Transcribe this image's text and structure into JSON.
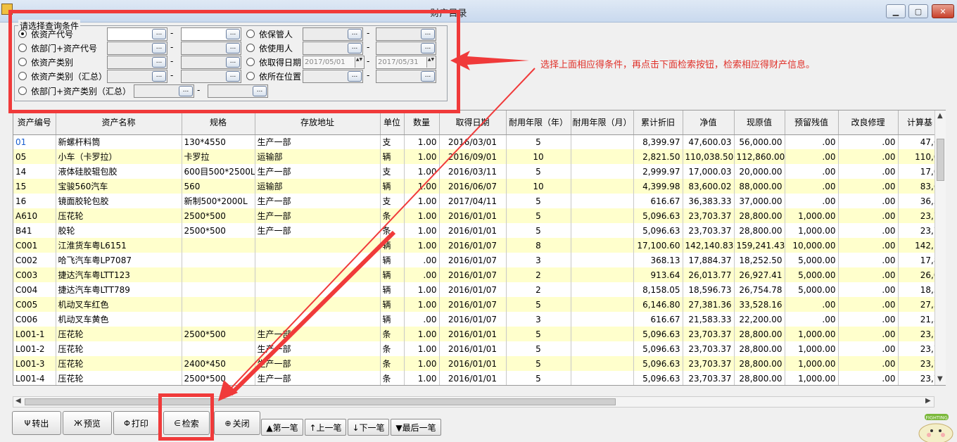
{
  "window": {
    "title": "财产目录",
    "min": "▁",
    "max": "▢",
    "close": "✕"
  },
  "filter": {
    "legend": "请选择查询条件",
    "left": [
      {
        "label": "依资产代号",
        "selected": true
      },
      {
        "label": "依部门+资产代号",
        "selected": false
      },
      {
        "label": "依资产类别",
        "selected": false
      },
      {
        "label": "依资产类别（汇总）",
        "selected": false
      },
      {
        "label": "依部门+资产类别（汇总）",
        "selected": false
      }
    ],
    "right": [
      {
        "label": "依保管人",
        "selected": false
      },
      {
        "label": "依使用人",
        "selected": false
      },
      {
        "label": "依取得日期",
        "selected": false
      },
      {
        "label": "依所在位置",
        "selected": false
      }
    ],
    "date_from": "2017/05/01",
    "date_to": "2017/05/31",
    "dash": "-",
    "dots": "..."
  },
  "annotation": "选择上面相应得条件，再点击下面检索按钮，检索相应得财产信息。",
  "table": {
    "columns": [
      "资产编号",
      "资产名称",
      "规格",
      "存放地址",
      "单位",
      "数量",
      "取得日期",
      "耐用年限（年）",
      "耐用年限（月）",
      "累计折旧",
      "净值",
      "现原值",
      "预留残值",
      "改良修理",
      "计算基"
    ],
    "rows": [
      [
        "01",
        "新螺杆料筒",
        "130*4550",
        "生产一部",
        "支",
        "1.00",
        "2016/03/01",
        "5",
        "",
        "8,399.97",
        "47,600.03",
        "56,000.00",
        ".00",
        ".00",
        "47,6"
      ],
      [
        "05",
        "小车（卡罗拉）",
        "卡罗拉",
        "运输部",
        "辆",
        "1.00",
        "2016/09/01",
        "10",
        "",
        "2,821.50",
        "110,038.50",
        "112,860.00",
        ".00",
        ".00",
        "110,0"
      ],
      [
        "14",
        "液体硅胶辊包胶",
        "600目500*2500L",
        "生产一部",
        "支",
        "1.00",
        "2016/03/11",
        "5",
        "",
        "2,999.97",
        "17,000.03",
        "20,000.00",
        ".00",
        ".00",
        "17,0"
      ],
      [
        "15",
        "宝骏560汽车",
        "560",
        "运输部",
        "辆",
        "1.00",
        "2016/06/07",
        "10",
        "",
        "4,399.98",
        "83,600.02",
        "88,000.00",
        ".00",
        ".00",
        "83,6"
      ],
      [
        "16",
        "镜面胶轮包胶",
        "新制500*2000L",
        "生产一部",
        "支",
        "1.00",
        "2017/04/11",
        "5",
        "",
        "616.67",
        "36,383.33",
        "37,000.00",
        ".00",
        ".00",
        "36,3"
      ],
      [
        "A610",
        "压花轮",
        "2500*500",
        "生产一部",
        "条",
        "1.00",
        "2016/01/01",
        "5",
        "",
        "5,096.63",
        "23,703.37",
        "28,800.00",
        "1,000.00",
        ".00",
        "23,7"
      ],
      [
        "B41",
        "胶轮",
        "2500*500",
        "生产一部",
        "条",
        "1.00",
        "2016/01/01",
        "5",
        "",
        "5,096.63",
        "23,703.37",
        "28,800.00",
        "1,000.00",
        ".00",
        "23,7"
      ],
      [
        "C001",
        "江淮货车粤L6151",
        "",
        "",
        "辆",
        "1.00",
        "2016/01/07",
        "8",
        "",
        "17,100.60",
        "142,140.83",
        "159,241.43",
        "10,000.00",
        ".00",
        "142,1"
      ],
      [
        "C002",
        "哈飞汽车粤LP7087",
        "",
        "",
        "辆",
        ".00",
        "2016/01/07",
        "3",
        "",
        "368.13",
        "17,884.37",
        "18,252.50",
        "5,000.00",
        ".00",
        "17,8"
      ],
      [
        "C003",
        "捷达汽车粤LTT123",
        "",
        "",
        "辆",
        ".00",
        "2016/01/07",
        "2",
        "",
        "913.64",
        "26,013.77",
        "26,927.41",
        "5,000.00",
        ".00",
        "26,0"
      ],
      [
        "C004",
        "捷达汽车粤LTT789",
        "",
        "",
        "辆",
        "1.00",
        "2016/01/07",
        "2",
        "",
        "8,158.05",
        "18,596.73",
        "26,754.78",
        "5,000.00",
        ".00",
        "18,5"
      ],
      [
        "C005",
        "机动叉车红色",
        "",
        "",
        "辆",
        "1.00",
        "2016/01/07",
        "5",
        "",
        "6,146.80",
        "27,381.36",
        "33,528.16",
        ".00",
        ".00",
        "27,3"
      ],
      [
        "C006",
        "机动叉车黄色",
        "",
        "",
        "辆",
        ".00",
        "2016/01/07",
        "3",
        "",
        "616.67",
        "21,583.33",
        "22,200.00",
        ".00",
        ".00",
        "21,5"
      ],
      [
        "L001-1",
        "压花轮",
        "2500*500",
        "生产一部",
        "条",
        "1.00",
        "2016/01/01",
        "5",
        "",
        "5,096.63",
        "23,703.37",
        "28,800.00",
        "1,000.00",
        ".00",
        "23,7"
      ],
      [
        "L001-2",
        "压花轮",
        "",
        "生产一部",
        "条",
        "1.00",
        "2016/01/01",
        "5",
        "",
        "5,096.63",
        "23,703.37",
        "28,800.00",
        "1,000.00",
        ".00",
        "23,7"
      ],
      [
        "L001-3",
        "压花轮",
        "2400*450",
        "生产一部",
        "条",
        "1.00",
        "2016/01/01",
        "5",
        "",
        "5,096.63",
        "23,703.37",
        "28,800.00",
        "1,000.00",
        ".00",
        "23,7"
      ],
      [
        "L001-4",
        "压花轮",
        "2500*500",
        "生产一部",
        "条",
        "1.00",
        "2016/01/01",
        "5",
        "",
        "5,096.63",
        "23,703.37",
        "28,800.00",
        "1,000.00",
        ".00",
        "23,7"
      ]
    ]
  },
  "buttons": {
    "export": {
      "icon": "Ψ",
      "label": "转出"
    },
    "preview": {
      "icon": "Ж",
      "label": "预览"
    },
    "print": {
      "icon": "Φ",
      "label": "打印"
    },
    "search": {
      "icon": "∈",
      "label": "检索"
    },
    "close": {
      "icon": "⊕",
      "label": "关闭"
    }
  },
  "nav": {
    "first": "▲第一笔",
    "prev": "↑上一笔",
    "next": "↓下一笔",
    "last": "▼最后一笔"
  },
  "mascot_text": "FIGHTING",
  "highlight_color": "#f03a3a"
}
